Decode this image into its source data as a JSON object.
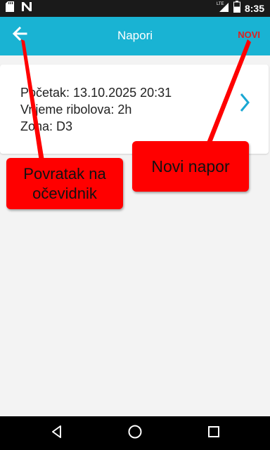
{
  "status_bar": {
    "time": "8:35",
    "network_label": "LTE",
    "battery_level": "0.55",
    "icons": [
      "sd-card-icon",
      "n-notification-icon",
      "lte-signal-icon",
      "battery-icon"
    ]
  },
  "app_bar": {
    "title": "Napori",
    "back_icon": "arrow-back-icon",
    "new_label": "NOVI"
  },
  "card": {
    "start_line": "Početak: 13.10.2025 20:31",
    "duration_line": "Vrijeme ribolova: 2h",
    "zone_line": "Zona: D3",
    "chevron_icon": "chevron-right-icon"
  },
  "annotations": {
    "back_note": "Povratak na očevidnik",
    "new_note": "Novi napor"
  },
  "nav_bar": {
    "icons": [
      "back-triangle-icon",
      "home-circle-icon",
      "recents-square-icon"
    ]
  },
  "colors": {
    "app_bar": "#19b3d3",
    "accent_red": "#e02020",
    "annotation_red": "#ff0000",
    "chevron": "#19a7d3"
  }
}
